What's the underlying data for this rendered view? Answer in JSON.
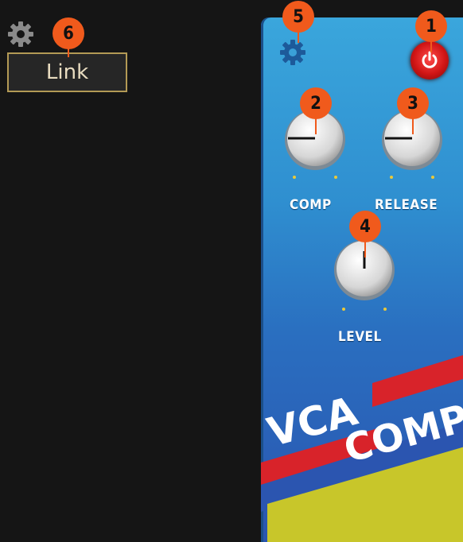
{
  "toolbar": {
    "settings_icon": "gear-icon",
    "link_label": "Link"
  },
  "pedal": {
    "settings_icon": "gear-icon",
    "power_icon": "power-icon",
    "knobs": {
      "comp": "COMP",
      "release": "RELEASE",
      "level": "LEVEL"
    },
    "logo": {
      "line1": "VCA",
      "line2": "COMP"
    }
  },
  "callouts": {
    "power": "1",
    "comp": "2",
    "release": "3",
    "level": "4",
    "settings": "5",
    "link": "6"
  },
  "colors": {
    "callout": "#f05a1c",
    "pedal_blue": "#2f8fd0",
    "power_red": "#d01515",
    "stripe_red": "#d8232a",
    "stripe_yellow": "#c8c62a"
  }
}
